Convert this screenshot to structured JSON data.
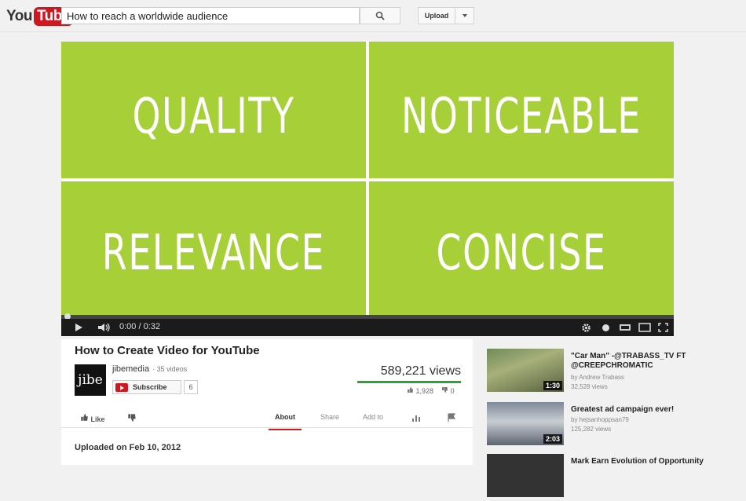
{
  "header": {
    "logo_you": "You",
    "logo_tube": "Tube",
    "search_value": "How to reach a worldwide audience",
    "upload_label": "Upload"
  },
  "video": {
    "quadrants": [
      "QUALITY",
      "NOTICEABLE",
      "RELEVANCE",
      "CONCISE"
    ],
    "time": "0:00 / 0:32",
    "progress": 0,
    "background_color": "#a6cf38"
  },
  "info": {
    "title": "How to Create Video for YouTube",
    "channel_logo": "jibe",
    "channel_name": "jibemedia",
    "channel_videos": "· 35 videos",
    "subscribe_label": "Subscribe",
    "subscriber_count": "6",
    "views": "589,221 views",
    "likes": "1,928",
    "dislikes": "0"
  },
  "actions": {
    "like": "Like",
    "about": "About",
    "share": "Share",
    "add_to": "Add to"
  },
  "about": {
    "uploaded": "Uploaded on Feb 10, 2012"
  },
  "sidebar": [
    {
      "title": "\"Car Man\" -@TRABASS_TV FT @CREEPCHROMATIC",
      "by": "by Andrew Trabass",
      "views": "32,528 views",
      "duration": "1:30"
    },
    {
      "title": "Greatest ad campaign ever!",
      "by": "by hejsanhoppsan79",
      "views": "125,282 views",
      "duration": "2:03"
    },
    {
      "title": "Mark Earn Evolution of Opportunity"
    }
  ]
}
